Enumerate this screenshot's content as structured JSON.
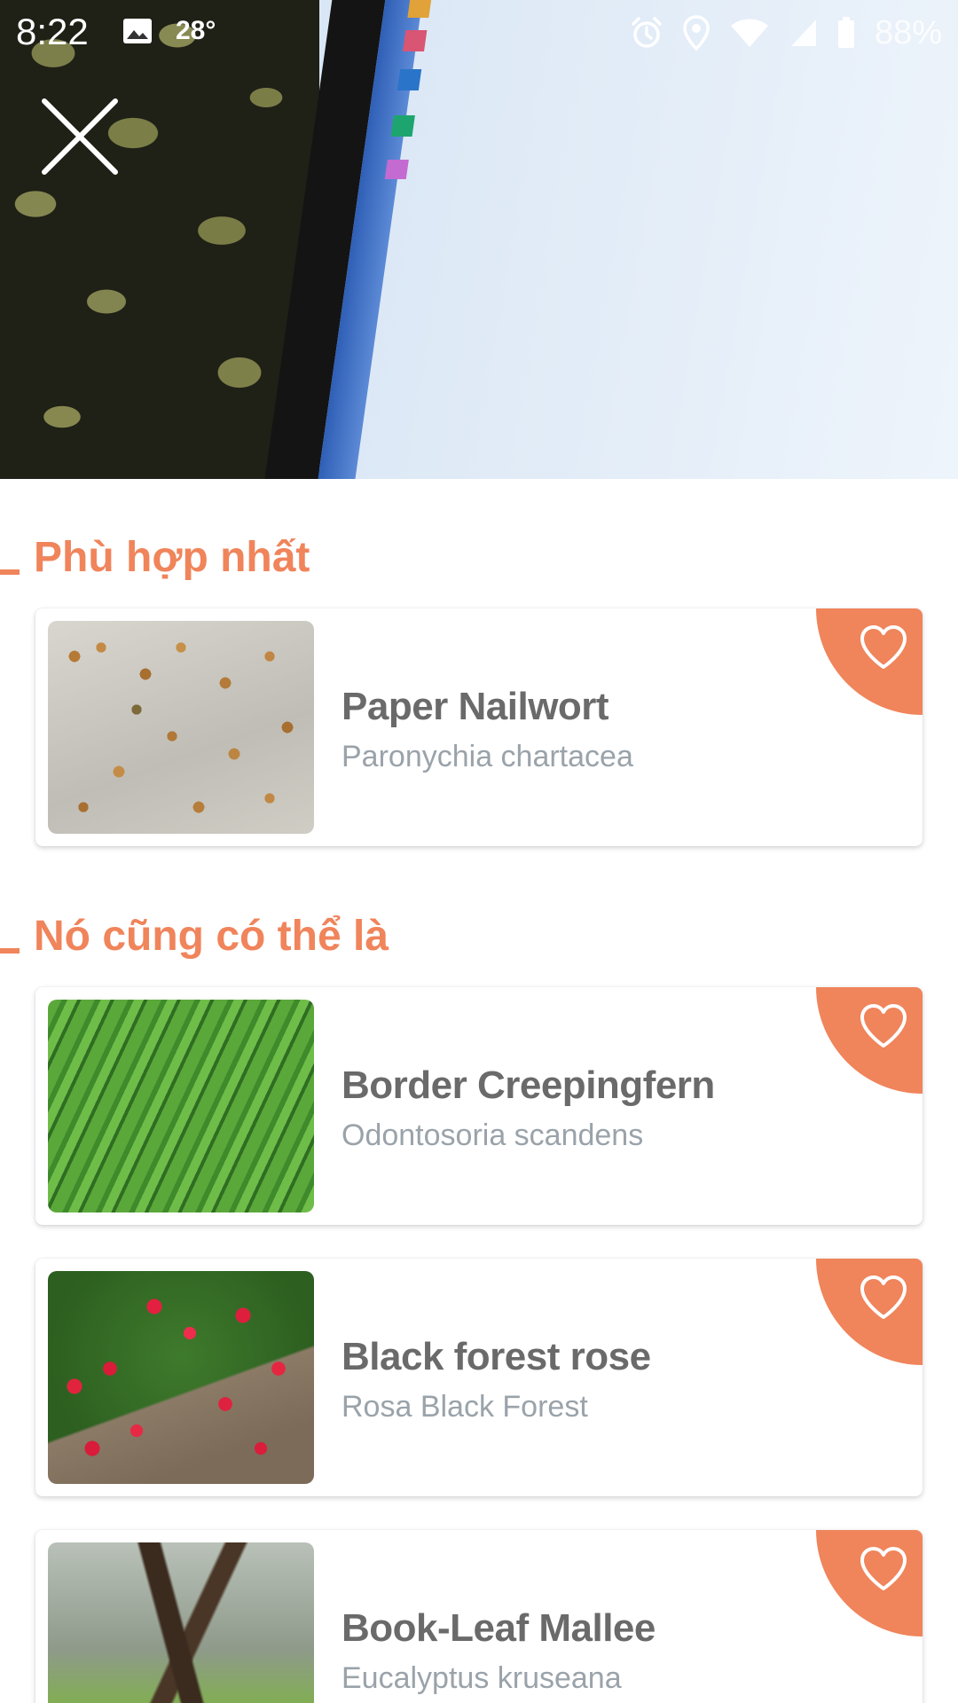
{
  "status_bar": {
    "time": "8:22",
    "temperature": "28°",
    "battery": "88%"
  },
  "colors": {
    "accent": "#f0845b",
    "title_text": "#6a6a6a",
    "subtitle_text": "#9aa3aa"
  },
  "header": {
    "close_icon": "close-icon"
  },
  "best_match": {
    "title": "Phù hợp nhất",
    "items": [
      {
        "name": "Paper Nailwort",
        "scientific": "Paronychia chartacea",
        "thumb": "thumb-nailwort"
      }
    ]
  },
  "alternatives": {
    "title": "Nó cũng có thể là",
    "items": [
      {
        "name": "Border Creepingfern",
        "scientific": "Odontosoria scandens",
        "thumb": "thumb-fern"
      },
      {
        "name": "Black forest rose",
        "scientific": "Rosa Black Forest",
        "thumb": "thumb-rose"
      },
      {
        "name": "Book-Leaf Mallee",
        "scientific": "Eucalyptus kruseana",
        "thumb": "thumb-mallee"
      }
    ]
  }
}
